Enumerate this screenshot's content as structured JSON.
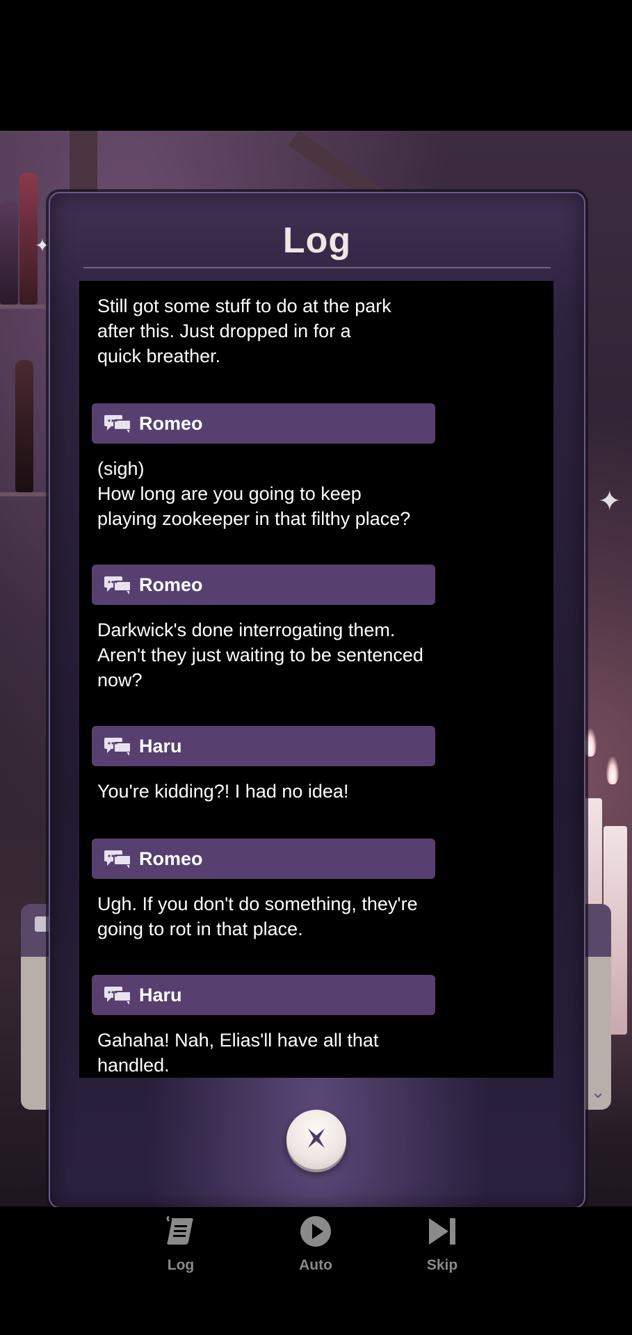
{
  "panel": {
    "title": "Log"
  },
  "log": {
    "entries": [
      {
        "speaker": "",
        "text": "Still got some stuff to do at the park\nafter this. Just dropped in for a\nquick breather."
      },
      {
        "speaker": "Romeo",
        "text": "(sigh)\nHow long are you going to keep\nplaying zookeeper in that filthy place?"
      },
      {
        "speaker": "Romeo",
        "text": "Darkwick's done interrogating them.\nAren't they just waiting to be sentenced\nnow?"
      },
      {
        "speaker": "Haru",
        "text": "You're kidding?! I had no idea!"
      },
      {
        "speaker": "Romeo",
        "text": "Ugh. If you don't do something, they're\ngoing to rot in that place."
      },
      {
        "speaker": "Haru",
        "text": "Gahaha! Nah, Elias'll have all that\nhandled."
      }
    ]
  },
  "toolbar": {
    "log_label": "Log",
    "auto_label": "Auto",
    "skip_label": "Skip"
  },
  "icons": {
    "speaker": "speech-bubbles-icon",
    "close": "close-x-icon",
    "log": "scroll-icon",
    "auto": "play-circle-icon",
    "skip": "skip-forward-icon"
  },
  "colors": {
    "speaker_bar": "#574070",
    "panel_border": "#6a5a86",
    "title": "#f1e6e6",
    "toolbar_label": "#8a8a8a"
  }
}
